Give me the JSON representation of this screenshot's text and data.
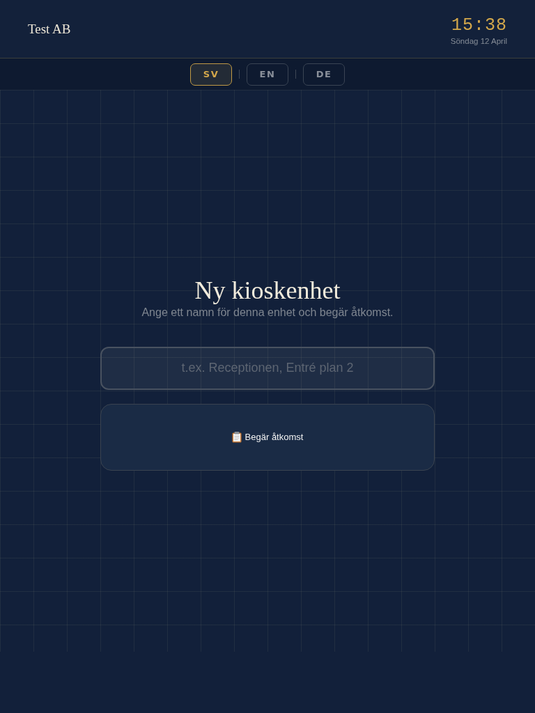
{
  "header": {
    "company": "Test AB",
    "time": "15:38",
    "date": "Söndag 12 April"
  },
  "languages": [
    {
      "label": "SV",
      "selected": true
    },
    {
      "label": "EN",
      "selected": false
    },
    {
      "label": "DE",
      "selected": false
    }
  ],
  "main": {
    "title": "Ny kioskenhet",
    "subtitle": "Ange ett namn för denna enhet och begär åtkomst.",
    "name_field": {
      "placeholder": "t.ex. Receptionen, Entré plan 2"
    },
    "request_button": {
      "label": "Begär åtkomst"
    }
  }
}
